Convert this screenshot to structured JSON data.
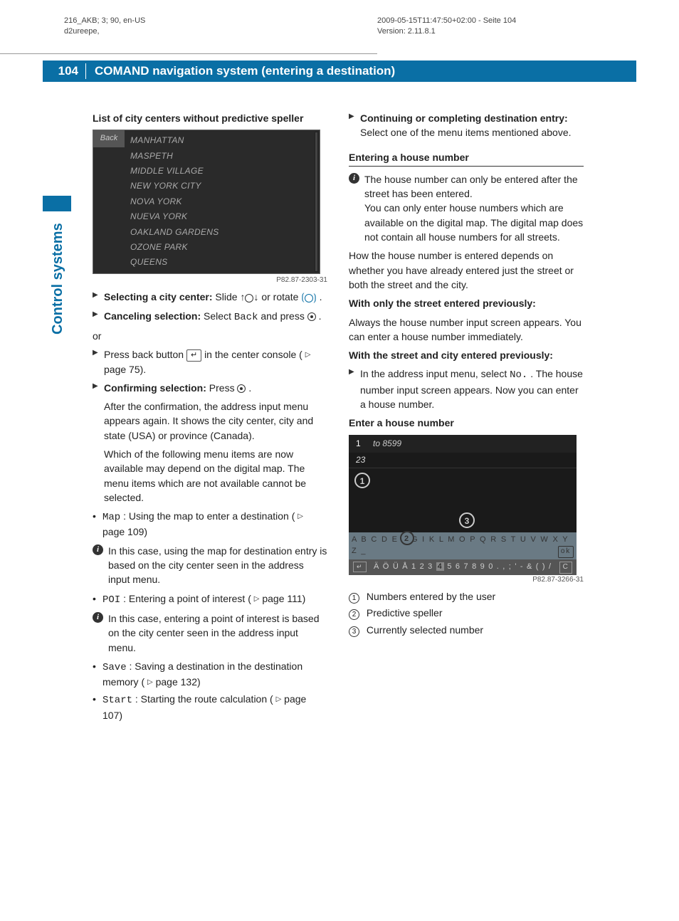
{
  "meta": {
    "left_line1": "216_AKB; 3; 90, en-US",
    "left_line2": "d2ureepe,",
    "right_line1": "2009-05-15T11:47:50+02:00 - Seite 104",
    "right_line2": "Version: 2.11.8.1"
  },
  "header": {
    "page_number": "104",
    "title": "COMAND navigation system (entering a destination)"
  },
  "side_tab": "Control systems",
  "left_col": {
    "h1": "List of city centers without predictive speller",
    "shot1": {
      "back": "Back",
      "items": [
        "MANHATTAN",
        "MASPETH",
        "MIDDLE VILLAGE",
        "NEW YORK CITY",
        "NOVA YORK",
        "NUEVA YORK",
        "OAKLAND GARDENS",
        "OZONE PARK",
        "QUEENS"
      ],
      "caption": "P82.87-2303-31"
    },
    "select_city_b": "Selecting a city center:",
    "select_city_t1": " Slide ",
    "select_city_t2": " or rotate ",
    "select_city_t3": ".",
    "cancel_b": "Canceling selection:",
    "cancel_t1": " Select ",
    "cancel_back": "Back",
    "cancel_t2": " and press ",
    "cancel_t3": ".",
    "or": "or",
    "pressback1": "Press back button ",
    "pressback2": " in the center console (",
    "pressback_page": " page 75).",
    "confirm_b": "Confirming selection:",
    "confirm_t1": " Press ",
    "confirm_t2": ".",
    "confirm_para": "After the confirmation, the address input menu appears again. It shows the city center, city and state (USA) or province (Canada).",
    "which_para": "Which of the following menu items are now available may depend on the digital map. The menu items which are not available cannot be selected.",
    "map_label": "Map",
    "map_text": ": Using the map to enter a destination (",
    "map_page": " page 109)",
    "info_map": "In this case, using the map for destination entry is based on the city center seen in the address input menu.",
    "poi_label": "POI",
    "poi_text": ": Entering a point of interest (",
    "poi_page": " page 111)",
    "info_poi": "In this case, entering a point of interest is based on the city center seen in the address input menu.",
    "save_label": "Save",
    "save_text": ": Saving a destination in the destination memory (",
    "save_page": " page 132)",
    "start_label": "Start",
    "start_text": ": Starting the route calculation (",
    "start_page": " page 107)"
  },
  "right_col": {
    "cont_b": "Continuing or completing destination entry:",
    "cont_t": " Select one of the menu items mentioned above.",
    "sub1": "Entering a house number",
    "info1a": "The house number can only be entered after the street has been entered.",
    "info1b": "You can only enter house numbers which are available on the digital map. The digital map does not contain all house numbers for all streets.",
    "para1": "How the house number is entered depends on whether you have already entered just the street or both the street and the city.",
    "bold1": "With only the street entered previously:",
    "para2": "Always the house number input screen appears. You can enter a house number immediately.",
    "bold2": "With the street and city entered previously:",
    "tri1a": "In the address input menu, select ",
    "tri1_no": "No.",
    "tri1b": ". The house number input screen appears. Now you can enter a house number.",
    "sub2": "Enter a house number",
    "shot2": {
      "top_num": "1",
      "top_to": "to 8599",
      "entered": "23",
      "row1": "A B C D E F G    I K L M  O P Q R S T U V W X Y Z _",
      "ok": "ok",
      "row2_pre": "Ä Ö Ü     Å 1 2 3",
      "row2_hl": "4",
      "row2_post": "5 6 7 8 9 0 . , ; ' - & ( ) /",
      "row2_c": "C",
      "caption": "P82.87-3266-31"
    },
    "legend": {
      "l1": "Numbers entered by the user",
      "l2": "Predictive speller",
      "l3": "Currently selected number"
    }
  }
}
